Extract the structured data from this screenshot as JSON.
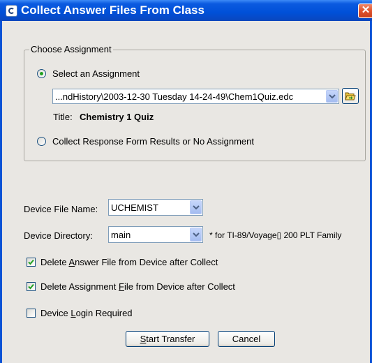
{
  "window": {
    "title": "Collect Answer Files From Class",
    "close_glyph": "✕"
  },
  "assignment_group": {
    "label": "Choose Assignment",
    "select_option": {
      "label": "Select an Assignment",
      "selected": true
    },
    "path_combo": {
      "value": "...ndHistory\\2003-12-30 Tuesday 14-24-49\\Chem1Quiz.edc"
    },
    "browse_icon": "folder-open-icon",
    "title_label": "Title:",
    "title_value": "Chemistry 1 Quiz",
    "no_assignment_option": {
      "label": "Collect Response Form Results or No Assignment",
      "selected": false
    }
  },
  "device": {
    "file_name_label": "Device File Name:",
    "file_name_value": "UCHEMIST",
    "directory_label": "Device Directory:",
    "directory_value": "main",
    "directory_note": "* for TI-89/Voyage▯ 200 PLT Family"
  },
  "options": {
    "delete_answer": {
      "pre": "Delete ",
      "accel": "A",
      "post": "nswer File from Device after Collect",
      "checked": true
    },
    "delete_assignment": {
      "pre": "Delete Assignment ",
      "accel": "F",
      "post": "ile from Device after Collect",
      "checked": true
    },
    "login_required": {
      "pre": "Device ",
      "accel": "L",
      "post": "ogin Required",
      "checked": false
    }
  },
  "buttons": {
    "start": {
      "accel": "S",
      "rest": "tart Transfer"
    },
    "cancel": "Cancel"
  },
  "colors": {
    "titlebar": "#0050d8",
    "dialog_bg": "#e9e7e3",
    "check_green": "#21a121"
  }
}
